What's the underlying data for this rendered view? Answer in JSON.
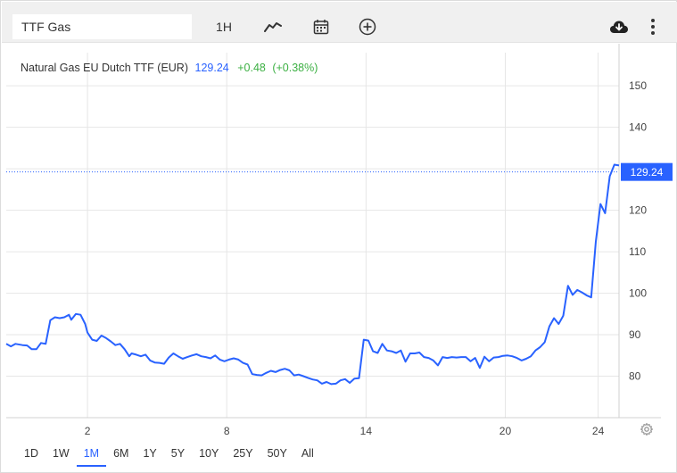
{
  "toolbar": {
    "symbol_value": "TTF Gas",
    "interval_label": "1H",
    "icons": [
      "line-chart-icon",
      "calendar-icon",
      "plus-circle-icon",
      "cloud-download-icon",
      "more-vertical-icon"
    ]
  },
  "legend": {
    "name": "Natural Gas EU Dutch TTF (EUR)",
    "price": "129.24",
    "change": "+0.48",
    "change_pct": "(+0.38%)"
  },
  "ranges": [
    {
      "label": "1D",
      "active": false
    },
    {
      "label": "1W",
      "active": false
    },
    {
      "label": "1M",
      "active": true
    },
    {
      "label": "6M",
      "active": false
    },
    {
      "label": "1Y",
      "active": false
    },
    {
      "label": "5Y",
      "active": false
    },
    {
      "label": "10Y",
      "active": false
    },
    {
      "label": "25Y",
      "active": false
    },
    {
      "label": "50Y",
      "active": false
    },
    {
      "label": "All",
      "active": false
    }
  ],
  "colors": {
    "line": "#2962ff",
    "positive": "#3cb043",
    "grid": "#e6e6e6",
    "price_label_bg": "#2962ff"
  },
  "chart_data": {
    "type": "line",
    "xlim": [
      -1.5,
      24.9
    ],
    "ylim": [
      70,
      158
    ],
    "x_ticks": [
      2,
      8,
      14,
      20,
      24
    ],
    "y_ticks": [
      80,
      90,
      100,
      110,
      120,
      130,
      140,
      150
    ],
    "last_price_label": "129.24",
    "last_price": 129.24,
    "grid": true,
    "series": [
      {
        "values": [
          [
            -1.5,
            87.8
          ],
          [
            -1.3,
            87.2
          ],
          [
            -1.1,
            87.8
          ],
          [
            -0.8,
            87.5
          ],
          [
            -0.6,
            87.4
          ],
          [
            -0.4,
            86.5
          ],
          [
            -0.2,
            86.5
          ],
          [
            0.0,
            88.0
          ],
          [
            0.2,
            87.8
          ],
          [
            0.4,
            93.5
          ],
          [
            0.6,
            94.2
          ],
          [
            0.8,
            94.0
          ],
          [
            1.0,
            94.2
          ],
          [
            1.2,
            94.8
          ],
          [
            1.3,
            93.6
          ],
          [
            1.5,
            95.0
          ],
          [
            1.7,
            94.8
          ],
          [
            1.9,
            92.6
          ],
          [
            2.0,
            90.5
          ],
          [
            2.2,
            88.8
          ],
          [
            2.4,
            88.5
          ],
          [
            2.6,
            89.8
          ],
          [
            2.8,
            89.2
          ],
          [
            3.0,
            88.4
          ],
          [
            3.2,
            87.5
          ],
          [
            3.4,
            87.8
          ],
          [
            3.6,
            86.5
          ],
          [
            3.8,
            84.8
          ],
          [
            3.9,
            85.5
          ],
          [
            4.1,
            85.2
          ],
          [
            4.3,
            84.8
          ],
          [
            4.5,
            85.2
          ],
          [
            4.7,
            83.8
          ],
          [
            4.9,
            83.3
          ],
          [
            5.1,
            83.2
          ],
          [
            5.3,
            83.0
          ],
          [
            5.5,
            84.5
          ],
          [
            5.7,
            85.5
          ],
          [
            5.9,
            84.8
          ],
          [
            6.1,
            84.2
          ],
          [
            6.3,
            84.6
          ],
          [
            6.5,
            85.0
          ],
          [
            6.7,
            85.3
          ],
          [
            6.9,
            84.8
          ],
          [
            7.1,
            84.6
          ],
          [
            7.3,
            84.3
          ],
          [
            7.5,
            85.0
          ],
          [
            7.7,
            84.0
          ],
          [
            7.9,
            83.6
          ],
          [
            8.1,
            84.0
          ],
          [
            8.3,
            84.3
          ],
          [
            8.5,
            84.0
          ],
          [
            8.7,
            83.2
          ],
          [
            8.9,
            82.8
          ],
          [
            9.1,
            80.5
          ],
          [
            9.3,
            80.3
          ],
          [
            9.5,
            80.2
          ],
          [
            9.7,
            80.8
          ],
          [
            9.9,
            81.3
          ],
          [
            10.1,
            81.0
          ],
          [
            10.3,
            81.5
          ],
          [
            10.5,
            81.8
          ],
          [
            10.7,
            81.4
          ],
          [
            10.9,
            80.2
          ],
          [
            11.1,
            80.4
          ],
          [
            11.3,
            80.0
          ],
          [
            11.5,
            79.6
          ],
          [
            11.7,
            79.2
          ],
          [
            11.9,
            79.0
          ],
          [
            12.1,
            78.2
          ],
          [
            12.3,
            78.6
          ],
          [
            12.5,
            78.1
          ],
          [
            12.7,
            78.2
          ],
          [
            12.9,
            79.0
          ],
          [
            13.1,
            79.3
          ],
          [
            13.3,
            78.4
          ],
          [
            13.5,
            79.4
          ],
          [
            13.7,
            79.5
          ],
          [
            13.9,
            88.8
          ],
          [
            14.1,
            88.6
          ],
          [
            14.3,
            86.0
          ],
          [
            14.5,
            85.6
          ],
          [
            14.7,
            87.8
          ],
          [
            14.9,
            86.2
          ],
          [
            15.1,
            86.0
          ],
          [
            15.3,
            85.6
          ],
          [
            15.5,
            86.2
          ],
          [
            15.7,
            83.5
          ],
          [
            15.9,
            85.5
          ],
          [
            16.1,
            85.5
          ],
          [
            16.3,
            85.7
          ],
          [
            16.5,
            84.6
          ],
          [
            16.7,
            84.4
          ],
          [
            16.9,
            83.8
          ],
          [
            17.1,
            82.6
          ],
          [
            17.3,
            84.6
          ],
          [
            17.5,
            84.4
          ],
          [
            17.7,
            84.6
          ],
          [
            17.9,
            84.5
          ],
          [
            18.1,
            84.6
          ],
          [
            18.3,
            84.6
          ],
          [
            18.5,
            83.6
          ],
          [
            18.7,
            84.4
          ],
          [
            18.9,
            82.0
          ],
          [
            19.1,
            84.7
          ],
          [
            19.3,
            83.6
          ],
          [
            19.5,
            84.5
          ],
          [
            19.7,
            84.6
          ],
          [
            19.9,
            84.9
          ],
          [
            20.1,
            85.0
          ],
          [
            20.3,
            84.8
          ],
          [
            20.5,
            84.4
          ],
          [
            20.7,
            83.8
          ],
          [
            20.9,
            84.2
          ],
          [
            21.1,
            84.8
          ],
          [
            21.3,
            86.2
          ],
          [
            21.5,
            87.0
          ],
          [
            21.7,
            88.2
          ],
          [
            21.9,
            92.0
          ],
          [
            22.1,
            94.0
          ],
          [
            22.3,
            92.6
          ],
          [
            22.5,
            94.6
          ],
          [
            22.7,
            101.8
          ],
          [
            22.9,
            99.6
          ],
          [
            23.1,
            100.8
          ],
          [
            23.3,
            100.2
          ],
          [
            23.5,
            99.5
          ],
          [
            23.7,
            99.0
          ],
          [
            23.9,
            112.5
          ],
          [
            24.1,
            121.5
          ],
          [
            24.3,
            119.3
          ],
          [
            24.5,
            128.2
          ],
          [
            24.7,
            131.0
          ],
          [
            24.9,
            130.8
          ]
        ]
      }
    ]
  }
}
